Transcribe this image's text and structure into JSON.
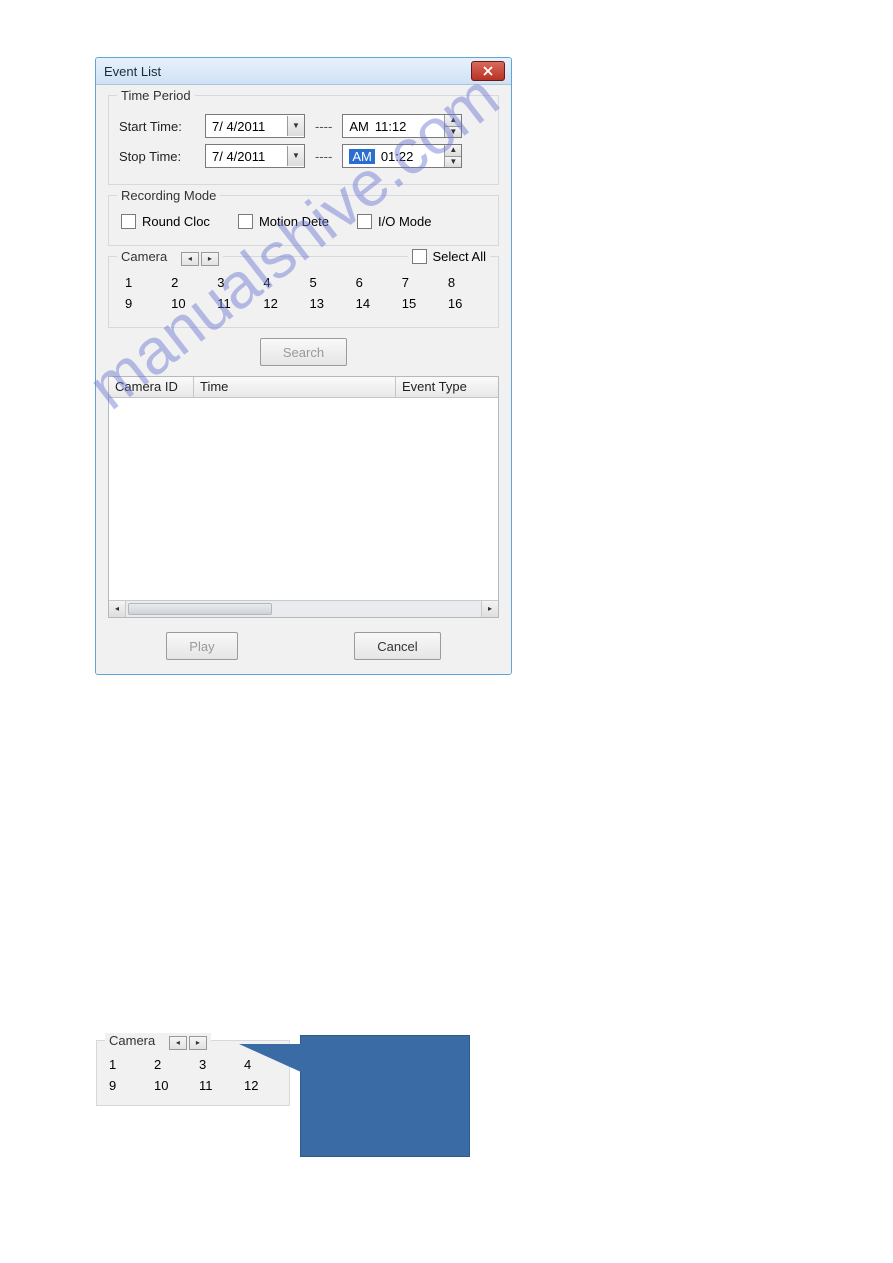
{
  "dialog": {
    "title": "Event List",
    "time_period": {
      "legend": "Time Period",
      "start_label": "Start Time:",
      "stop_label": "Stop Time:",
      "start_date": "7/  4/2011",
      "stop_date": "7/  4/2011",
      "sep": "----",
      "start_ampm": "AM",
      "start_time": "11:12",
      "stop_ampm": "AM",
      "stop_time": "01:22"
    },
    "recording_mode": {
      "legend": "Recording Mode",
      "round": "Round Cloc",
      "motion": "Motion Dete",
      "io": "I/O Mode"
    },
    "camera": {
      "legend": "Camera",
      "select_all": "Select All",
      "items": [
        "1",
        "2",
        "3",
        "4",
        "5",
        "6",
        "7",
        "8",
        "9",
        "10",
        "11",
        "12",
        "13",
        "14",
        "15",
        "16"
      ]
    },
    "search_label": "Search",
    "list": {
      "col_camera": "Camera ID",
      "col_time": "Time",
      "col_event": "Event Type"
    },
    "play_label": "Play",
    "cancel_label": "Cancel"
  },
  "watermark": "manualshive.com",
  "crop": {
    "legend": "Camera",
    "items": [
      "1",
      "2",
      "3",
      "4",
      "9",
      "10",
      "11",
      "12"
    ]
  }
}
